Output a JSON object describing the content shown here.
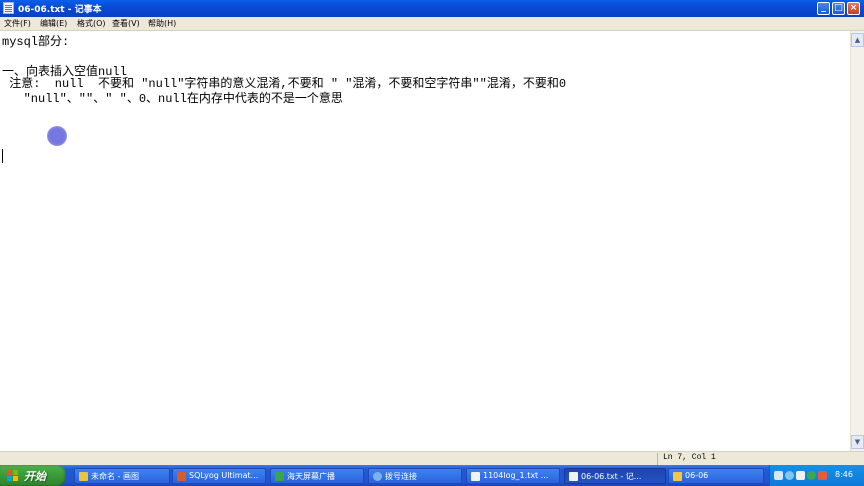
{
  "window": {
    "title": "06-06.txt - 记事本",
    "buttons": {
      "minimize": "_",
      "maximize": "□",
      "close": "×"
    }
  },
  "menu": {
    "items": [
      {
        "label": "文件(F)"
      },
      {
        "label": "编辑(E)"
      },
      {
        "label": "格式(O)"
      },
      {
        "label": "查看(V)"
      },
      {
        "label": "帮助(H)"
      }
    ]
  },
  "editor": {
    "lines": [
      "mysql部分:",
      "",
      "一、向表插入空值null",
      " 注意:  null  不要和 \"null\"字符串的意义混淆,不要和 \" \"混淆，不要和空字符串\"\"混淆，不要和0",
      "   \"null\"、\"\"、\" \"、0、null在内存中代表的不是一个意思"
    ]
  },
  "status": {
    "position": "Ln 7, Col 1"
  },
  "taskbar": {
    "start_label": "开始",
    "tasks": [
      {
        "label": "未命名 - 画图",
        "icon_color": "#e9c440"
      },
      {
        "label": "SQLyog Ultimat...",
        "icon_color": "#d95a2b"
      },
      {
        "label": "海天屏幕广播",
        "icon_color": "#3da34a"
      },
      {
        "label": "拨号连接",
        "icon_color": "#7bb4ea"
      },
      {
        "label": "1104log_1.txt ...",
        "icon_color": "#f2f2f2"
      },
      {
        "label": "06-06.txt - 记...",
        "icon_color": "#f2f2f2",
        "active": true
      },
      {
        "label": "06-06",
        "icon_color": "#f2c84b"
      }
    ],
    "clock": "8:46"
  }
}
